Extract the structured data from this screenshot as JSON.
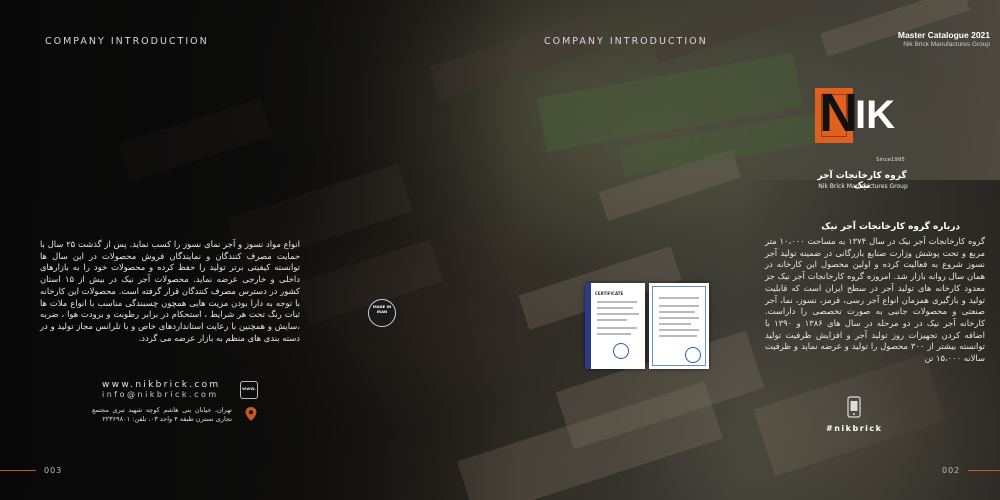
{
  "header": {
    "left_title": "COMPANY INTRODUCTION",
    "right_title": "COMPANY INTRODUCTION",
    "catalogue_title": "Master Catalogue 2021",
    "catalogue_sub": "Nik Brick Manufactures Group"
  },
  "logo": {
    "letter_n": "N",
    "letters_ik": "IK",
    "since": "Since1995",
    "name_fa": "گروه کارخانجات آجر نیک",
    "name_en": "Nik Brick Manufactures Group"
  },
  "about": {
    "title": "درباره گروه کارخانجات آجر نیک",
    "para_right": "گروه کارخانجات آجر نیک در سال ۱۳۷۴ به مساحت ۱۰،۰۰۰ متر مربع و تحت پوشش وزارت صنایع بازرگانی در ضمینه تولید آجر نسوز شروع به فعالیت کرده و اولین محصول این کارخانه در همان سال روانه بازار شد. امروزه گروه کارخانجات آجر نیک جز معدود کارخانه های تولید آجر در سطح ایران است که قابلیت تولید و بازگیری همزمان انواع آجر رسی، قرمز، نسوز، نما، آجر صنعتی و محصولات جانبی به صورت تخصصی را داراست. کارخانه آجر نیک در دو مرحله در سال های ۱۳۸۶ و ۱۳۹۰ با اضافه کردن تجهیزات روز تولید آجر و افزایش ظرفیت تولید توانسته بیشتر از ۳۰۰ محصول را تولید و عرضه نماید و ظرفیت سالانه ۱۵،۰۰۰ تن",
    "para_left": "انواع مواد نسوز و آجر نمای نسوز را کسب نماید. پس از گذشت ۲۵ سال با حمایت مصرف کنندگان و نمایندگان فروش محصولات در این سال ها توانسته کیفیتی برتر تولید را حفظ کرده و محصولات خود را به بازارهای داخلی و خارجی عرضه نماید. محصولات آجر نیک در بیش از ۱۵ استان کشور در دسترس مصرف کنندگان قرار گرفته است. محصولات این کارخانه با توجه به دارا بودن مزیت هایی همچون چسبندگی مناسب با انواع ملات ها ثبات رنگ تحت هر شرایط ، استحکام در برابر رطوبت و برودت هوا ، ضربه ،سایش و همچنین با رعایت استانداردهای خاص و با تلرانس مجاز تولید و در دسته بندی های منظم به بازار عرضه می گردد."
  },
  "certificates": {
    "cert1_title": "CERTIFICATE"
  },
  "badge": {
    "text": "MADE IN IRAN"
  },
  "contact": {
    "website": "www.nikbrick.com",
    "email": "info@nikbrick.com",
    "web_icon": "www.",
    "address": "تهران، خیابان بنی هاشم کوچه شهید تبری مجتمع تجاری نسترن طبقه ۴ واحد ۰۳، تلفن: ۲۲۳۶۹۸۰۱"
  },
  "social": {
    "hashtag": "#nikbrick"
  },
  "pages": {
    "left": "003",
    "right": "002"
  },
  "colors": {
    "accent": "#e0601f",
    "background": "#0c0c0c"
  }
}
